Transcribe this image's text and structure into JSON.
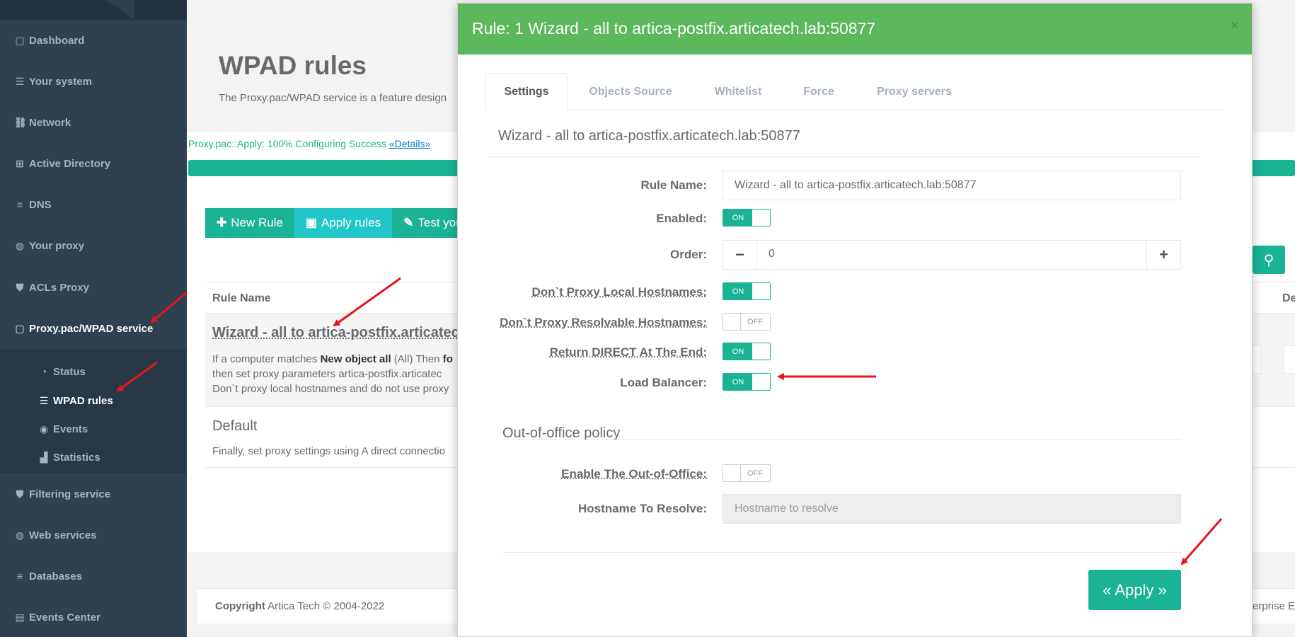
{
  "colors": {
    "sidebar": "#2f4050",
    "primary": "#1ab394",
    "info": "#23c6c8",
    "modal_header": "#5cb85c",
    "arrow": "#e8141b"
  },
  "sidebar": {
    "items": [
      {
        "icon": "book-icon",
        "glyph": "▢",
        "label": "Dashboard"
      },
      {
        "icon": "list-icon",
        "glyph": "☰",
        "label": "Your system"
      },
      {
        "icon": "sitemap-icon",
        "glyph": "⛓",
        "label": "Network"
      },
      {
        "icon": "windows-icon",
        "glyph": "⊞",
        "label": "Active Directory"
      },
      {
        "icon": "database-icon",
        "glyph": "≡",
        "label": "DNS"
      },
      {
        "icon": "globe-icon",
        "glyph": "◍",
        "label": "Your proxy"
      },
      {
        "icon": "shield-icon",
        "glyph": "⛊",
        "label": "ACLs Proxy"
      },
      {
        "icon": "book-icon",
        "glyph": "▢",
        "label": "Proxy.pac/WPAD service"
      },
      {
        "icon": "shield-icon",
        "glyph": "⛊",
        "label": "Filtering service"
      },
      {
        "icon": "globe-icon",
        "glyph": "◍",
        "label": "Web services"
      },
      {
        "icon": "database-icon",
        "glyph": "≡",
        "label": "Databases"
      },
      {
        "icon": "file-icon",
        "glyph": "▤",
        "label": "Events Center"
      }
    ],
    "subitems": [
      {
        "icon": "dashboard-icon",
        "glyph": "◔",
        "label": "Status"
      },
      {
        "icon": "list-icon",
        "glyph": "☰",
        "label": "WPAD rules"
      },
      {
        "icon": "eye-icon",
        "glyph": "◉",
        "label": "Events"
      },
      {
        "icon": "chart-icon",
        "glyph": "▟",
        "label": "Statistics"
      }
    ]
  },
  "page": {
    "title": "WPAD rules",
    "description": "The Proxy.pac/WPAD service is a feature design",
    "status_text": "Proxy.pac::Apply: 100% Configuring Success",
    "status_link": "«Details»",
    "progress_percent": 100
  },
  "toolbar": {
    "new_rule": "New Rule",
    "apply_rules": "Apply rules",
    "test": "Test you"
  },
  "table": {
    "col_rule_name": "Rule Name",
    "col_right": "De",
    "rows": [
      {
        "name": "Wizard - all to artica-postfix.articatech",
        "line1_prefix": "If a computer matches ",
        "line1_bold": "New object all",
        "line1_suffix": " (All) Then ",
        "line1_bold2": "fo",
        "line2": "then set proxy parameters artica-postfix.articatec",
        "line3": "Don`t proxy local hostnames and do not use proxy"
      },
      {
        "name": "Default",
        "line1": "Finally, set proxy settings using A direct connectio"
      }
    ]
  },
  "footer": {
    "copyright_bold": "Copyright",
    "copyright_rest": " Artica Tech © 2004-2022",
    "right": "erprise E"
  },
  "modal": {
    "title": "Rule: 1 Wizard - all to artica-postfix.articatech.lab:50877",
    "close": "×",
    "tabs": [
      "Settings",
      "Objects Source",
      "Whitelist",
      "Force",
      "Proxy servers"
    ],
    "section_title": "Wizard - all to artica-postfix.articatech.lab:50877",
    "fields": {
      "rule_name_label": "Rule Name:",
      "rule_name_value": "Wizard - all to artica-postfix.articatech.lab:50877",
      "enabled_label": "Enabled:",
      "enabled": "ON",
      "order_label": "Order:",
      "order_value": "0",
      "dont_proxy_local_label": "Don`t Proxy Local Hostnames:",
      "dont_proxy_local": "ON",
      "dont_proxy_resolvable_label": "Don`t Proxy Resolvable Hostnames:",
      "dont_proxy_resolvable": "OFF",
      "return_direct_label": "Return DIRECT At The End:",
      "return_direct": "ON",
      "load_balancer_label": "Load Balancer:",
      "load_balancer": "ON"
    },
    "oof_title": "Out-of-office policy",
    "oof": {
      "enable_label": "Enable The Out-of-Office:",
      "enable": "OFF",
      "hostname_label": "Hostname To Resolve:",
      "hostname_placeholder": "Hostname to resolve"
    },
    "apply": "« Apply »"
  }
}
